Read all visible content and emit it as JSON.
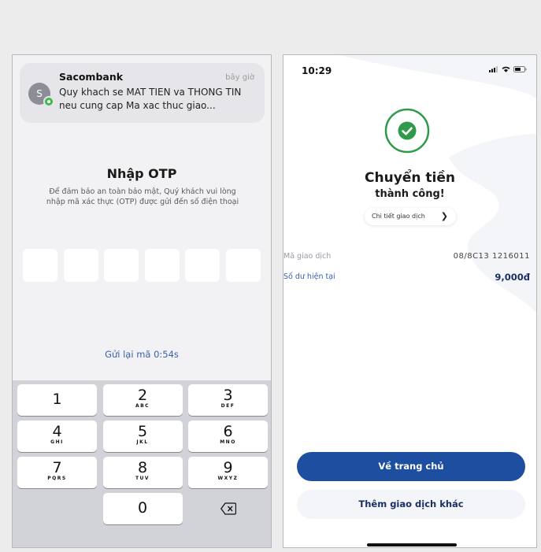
{
  "otp_screen": {
    "notification": {
      "avatar_letter": "S",
      "sender": "Sacombank",
      "time": "bây giờ",
      "message": "Quy khach se MAT TIEN va THONG TIN neu cung cap Ma xac thuc giao..."
    },
    "title": "Nhập OTP",
    "description": "Để đảm bảo an toàn bảo mật, Quý khách vui lòng nhập mã xác thực (OTP) được gửi đến số điện thoại",
    "otp_box_count": 6,
    "resend_label": "Gửi lại mã 0:54s",
    "keypad": [
      {
        "digit": "1",
        "letters": ""
      },
      {
        "digit": "2",
        "letters": "ABC"
      },
      {
        "digit": "3",
        "letters": "DEF"
      },
      {
        "digit": "4",
        "letters": "GHI"
      },
      {
        "digit": "5",
        "letters": "JKL"
      },
      {
        "digit": "6",
        "letters": "MNO"
      },
      {
        "digit": "7",
        "letters": "PQRS"
      },
      {
        "digit": "8",
        "letters": "TUV"
      },
      {
        "digit": "9",
        "letters": "WXYZ"
      },
      {
        "digit": "0",
        "letters": ""
      }
    ],
    "delete_icon": "backspace-icon"
  },
  "success_screen": {
    "status_time": "10:29",
    "title": "Chuyển tiền",
    "subtitle": "thành công!",
    "detail_link": "Chi tiết giao dịch",
    "rows": [
      {
        "label": "Mã giao dịch",
        "value": "08/8C13 1216011"
      },
      {
        "label": "Số dư hiện tại",
        "value": "9,000đ"
      }
    ],
    "primary_button": "Về trang chủ",
    "secondary_button": "Thêm giao dịch khác",
    "colors": {
      "accent": "#1d4ea0",
      "success": "#2e9a4a"
    }
  }
}
